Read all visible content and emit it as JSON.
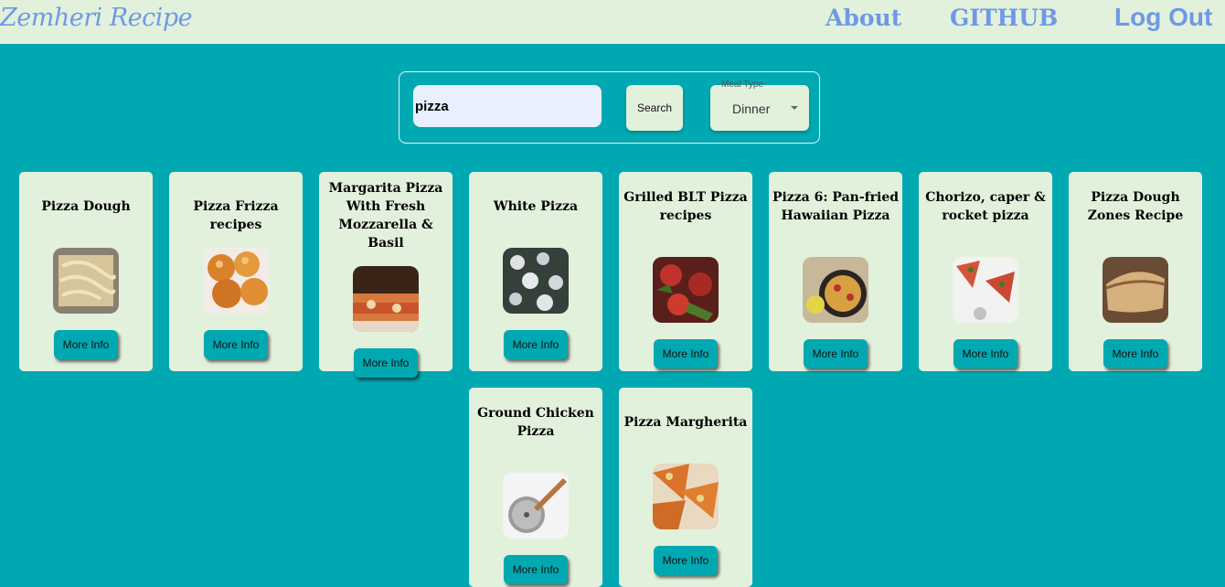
{
  "brand": "Zemheri Recipe",
  "nav": {
    "about": "About",
    "github": "GITHUB",
    "logout": "Log Out"
  },
  "search": {
    "value": "pizza",
    "button": "Search",
    "meal_type_label": "Meal Type",
    "meal_type_value": "Dinner"
  },
  "more_info_label": "More Info",
  "recipes": [
    {
      "title": "Pizza Dough",
      "icon": "pizza-dough-photo"
    },
    {
      "title": "Pizza Frizza recipes",
      "icon": "fried-dough-balls-photo"
    },
    {
      "title": "Margarita Pizza With Fresh Mozzarella & Basil",
      "icon": "margarita-pizza-photo"
    },
    {
      "title": "White Pizza",
      "icon": "white-pizza-photo"
    },
    {
      "title": "Grilled BLT Pizza recipes",
      "icon": "blt-pizza-photo"
    },
    {
      "title": "Pizza 6: Pan-fried Hawaiian Pizza",
      "icon": "pan-pizza-photo"
    },
    {
      "title": "Chorizo, caper & rocket pizza",
      "icon": "chorizo-pizza-photo"
    },
    {
      "title": "Pizza Dough Zones Recipe",
      "icon": "folded-dough-photo"
    },
    {
      "title": "Ground Chicken Pizza",
      "icon": "pizza-cutter-photo"
    },
    {
      "title": "Pizza Margherita",
      "icon": "margherita-slices-photo"
    }
  ],
  "colors": {
    "background": "#00a9b2",
    "nav_background": "#e2f1dc",
    "card_background": "#e2f1dc",
    "link": "#6f99e6"
  }
}
